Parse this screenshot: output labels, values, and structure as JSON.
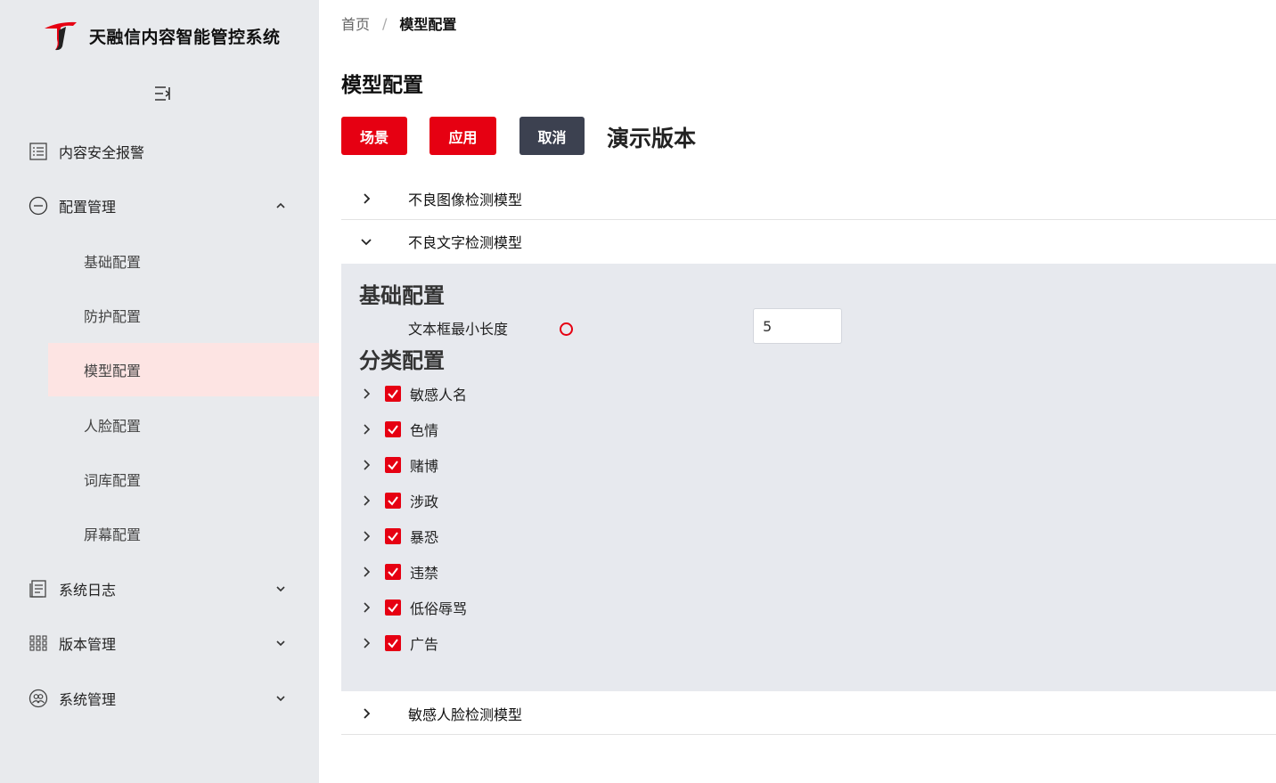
{
  "brand": {
    "title": "天融信内容智能管控系统",
    "accent": "#e60012"
  },
  "sidebar": {
    "menu": [
      {
        "label": "内容安全报警",
        "icon": "list-icon"
      },
      {
        "label": "配置管理",
        "icon": "minus-circle-icon",
        "expanded": true
      },
      {
        "label": "系统日志",
        "icon": "document-icon"
      },
      {
        "label": "版本管理",
        "icon": "grid-icon"
      },
      {
        "label": "系统管理",
        "icon": "users-icon"
      }
    ],
    "submenu": [
      {
        "label": "基础配置"
      },
      {
        "label": "防护配置"
      },
      {
        "label": "模型配置",
        "active": true
      },
      {
        "label": "人脸配置"
      },
      {
        "label": "词库配置"
      },
      {
        "label": "屏幕配置"
      }
    ]
  },
  "breadcrumb": {
    "home": "首页",
    "separator": "/",
    "current": "模型配置"
  },
  "page": {
    "title": "模型配置"
  },
  "toolbar": {
    "scene_label": "场景",
    "apply_label": "应用",
    "cancel_label": "取消",
    "demo_label": "演示版本"
  },
  "models": [
    {
      "label": "不良图像检测模型",
      "expanded": false
    },
    {
      "label": "不良文字检测模型",
      "expanded": true
    },
    {
      "label": "敏感人脸检测模型",
      "expanded": false
    }
  ],
  "text_model": {
    "basic_title": "基础配置",
    "min_length_label": "文本框最小长度",
    "min_length_value": "5",
    "category_title": "分类配置",
    "categories": [
      {
        "label": "敏感人名",
        "checked": true
      },
      {
        "label": "色情",
        "checked": true
      },
      {
        "label": "赌博",
        "checked": true
      },
      {
        "label": "涉政",
        "checked": true
      },
      {
        "label": "暴恐",
        "checked": true
      },
      {
        "label": "违禁",
        "checked": true
      },
      {
        "label": "低俗辱骂",
        "checked": true
      },
      {
        "label": "广告",
        "checked": true
      }
    ]
  }
}
